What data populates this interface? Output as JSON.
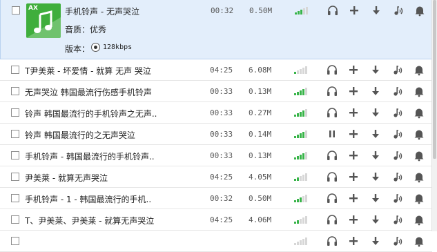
{
  "expanded": {
    "title": "手机铃声 - 无声哭泣",
    "duration": "00:32",
    "size": "0.50M",
    "signal": 3,
    "cover_text": "AX",
    "quality_label": "音质：优秀",
    "version_label": "版本：",
    "version_value": "128kbps"
  },
  "rows": [
    {
      "title": "T尹美莱 - 坏爱情 - 就算 无声 哭泣",
      "duration": "04:25",
      "size": "6.08M",
      "signal": 1,
      "play_icon": "headphones-icon"
    },
    {
      "title": "无声哭泣 韩国最流行伤感手机铃声",
      "duration": "00:33",
      "size": "0.13M",
      "signal": 4,
      "play_icon": "headphones-icon"
    },
    {
      "title": "铃声 韩国最流行的手机铃声之无声..",
      "duration": "00:33",
      "size": "0.27M",
      "signal": 4,
      "play_icon": "headphones-icon"
    },
    {
      "title": "铃声 韩国最流行的之无声哭泣",
      "duration": "00:33",
      "size": "0.14M",
      "signal": 4,
      "play_icon": "pause-icon"
    },
    {
      "title": "手机铃声 - 韩国最流行的手机铃声..",
      "duration": "00:33",
      "size": "0.13M",
      "signal": 4,
      "play_icon": "headphones-icon"
    },
    {
      "title": "尹美莱 - 就算无声哭泣",
      "duration": "04:25",
      "size": "4.05M",
      "signal": 2,
      "play_icon": "headphones-icon"
    },
    {
      "title": "手机铃声 - 1 - 韩国最流行的手机..",
      "duration": "00:32",
      "size": "0.50M",
      "signal": 3,
      "play_icon": "headphones-icon"
    },
    {
      "title": "T、尹美莱、尹美莱 - 就算无声哭泣",
      "duration": "04:25",
      "size": "4.06M",
      "signal": 2,
      "play_icon": "headphones-icon"
    },
    {
      "title": "",
      "duration": "",
      "size": "",
      "signal": 0,
      "play_icon": "headphones-icon"
    }
  ],
  "colors": {
    "signal_on": "#38b449",
    "signal_off": "#d7d7d7",
    "selected_bg": "#e3eefb",
    "cover": "#3fae3c"
  }
}
